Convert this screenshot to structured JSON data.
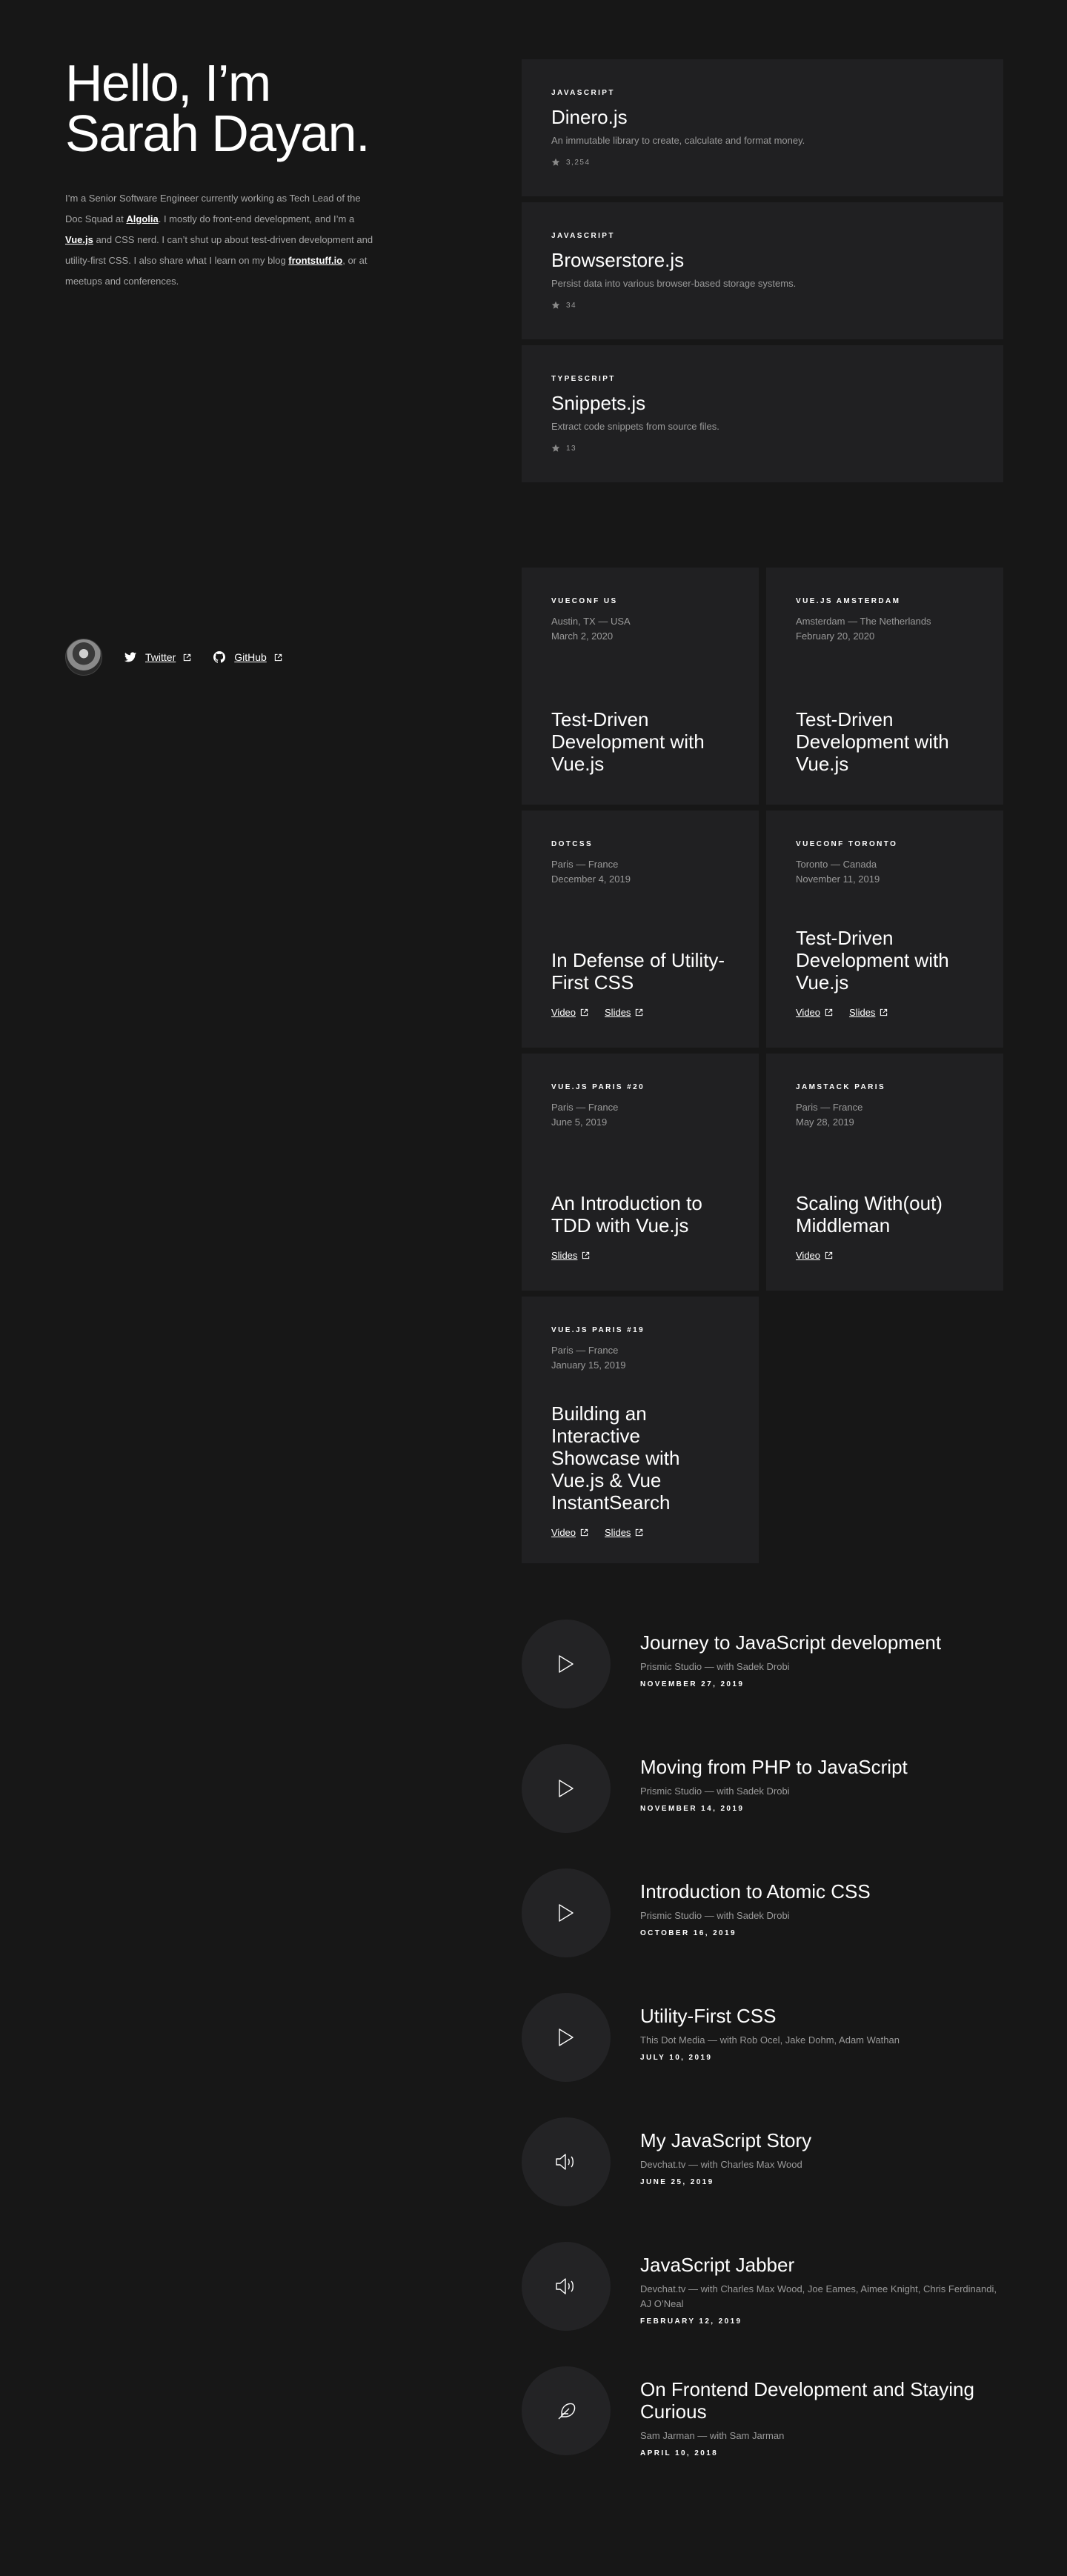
{
  "hero": {
    "line1": "Hello, I’m",
    "line2": "Sarah Dayan."
  },
  "bio": {
    "t1": "I’m a Senior Software Engineer currently working as Tech Lead of the Doc Squad at ",
    "algolia": "Algolia",
    "t2": ". I mostly do front-end development, and I’m a ",
    "vue": "Vue.js",
    "t3": " and CSS nerd. I can’t shut up about test-driven development and utility-first CSS. I also share what I learn on my blog ",
    "blog": "frontstuff.io",
    "t4": ", or at meetups and conferences."
  },
  "social": {
    "twitter": "Twitter",
    "github": "GitHub"
  },
  "projects": [
    {
      "lang": "JAVASCRIPT",
      "name": "Dinero.js",
      "desc": "An immutable library to create, calculate and format money.",
      "stars": "3,254"
    },
    {
      "lang": "JAVASCRIPT",
      "name": "Browserstore.js",
      "desc": "Persist data into various browser-based storage systems.",
      "stars": "34"
    },
    {
      "lang": "TYPESCRIPT",
      "name": "Snippets.js",
      "desc": "Extract code snippets from source files.",
      "stars": "13"
    }
  ],
  "talks": [
    {
      "event": "VUECONF US",
      "place": "Austin, TX — USA",
      "date": "March 2, 2020",
      "title": "Test-Driven Development with Vue.js",
      "links": []
    },
    {
      "event": "VUE.JS AMSTERDAM",
      "place": "Amsterdam — The Netherlands",
      "date": "February 20, 2020",
      "title": "Test-Driven Development with Vue.js",
      "links": []
    },
    {
      "event": "DOTCSS",
      "place": "Paris — France",
      "date": "December 4, 2019",
      "title": "In Defense of Utility-First CSS",
      "links": [
        "Video",
        "Slides"
      ]
    },
    {
      "event": "VUECONF TORONTO",
      "place": "Toronto — Canada",
      "date": "November 11, 2019",
      "title": "Test-Driven Development with Vue.js",
      "links": [
        "Video",
        "Slides"
      ]
    },
    {
      "event": "VUE.JS PARIS #20",
      "place": "Paris — France",
      "date": "June 5, 2019",
      "title": "An Introduction to TDD with Vue.js",
      "links": [
        "Slides"
      ]
    },
    {
      "event": "JAMSTACK PARIS",
      "place": "Paris — France",
      "date": "May 28, 2019",
      "title": "Scaling With(out) Middleman",
      "links": [
        "Video"
      ]
    },
    {
      "event": "VUE.JS PARIS #19",
      "place": "Paris — France",
      "date": "January 15, 2019",
      "title": "Building an Interactive Showcase with Vue.js & Vue InstantSearch",
      "links": [
        "Video",
        "Slides"
      ]
    }
  ],
  "episodes": [
    {
      "icon": "play-icon",
      "title": "Journey to JavaScript development",
      "meta": "Prismic Studio — with Sadek Drobi",
      "date": "NOVEMBER 27, 2019"
    },
    {
      "icon": "play-icon",
      "title": "Moving from PHP to JavaScript",
      "meta": "Prismic Studio — with Sadek Drobi",
      "date": "NOVEMBER 14, 2019"
    },
    {
      "icon": "play-icon",
      "title": "Introduction to Atomic CSS",
      "meta": "Prismic Studio — with Sadek Drobi",
      "date": "OCTOBER 16, 2019"
    },
    {
      "icon": "play-icon",
      "title": "Utility-First CSS",
      "meta": "This Dot Media — with Rob Ocel, Jake Dohm, Adam Wathan",
      "date": "JULY 10, 2019"
    },
    {
      "icon": "speaker-icon",
      "title": "My JavaScript Story",
      "meta": "Devchat.tv — with Charles Max Wood",
      "date": "JUNE 25, 2019"
    },
    {
      "icon": "speaker-icon",
      "title": "JavaScript Jabber",
      "meta": "Devchat.tv — with Charles Max Wood, Joe Eames, Aimee Knight, Chris Ferdinandi, AJ O’Neal",
      "date": "FEBRUARY 12, 2019"
    },
    {
      "icon": "feather-icon",
      "title": "On Frontend Development and Staying Curious",
      "meta": "Sam Jarman — with Sam Jarman",
      "date": "APRIL 10, 2018"
    }
  ]
}
